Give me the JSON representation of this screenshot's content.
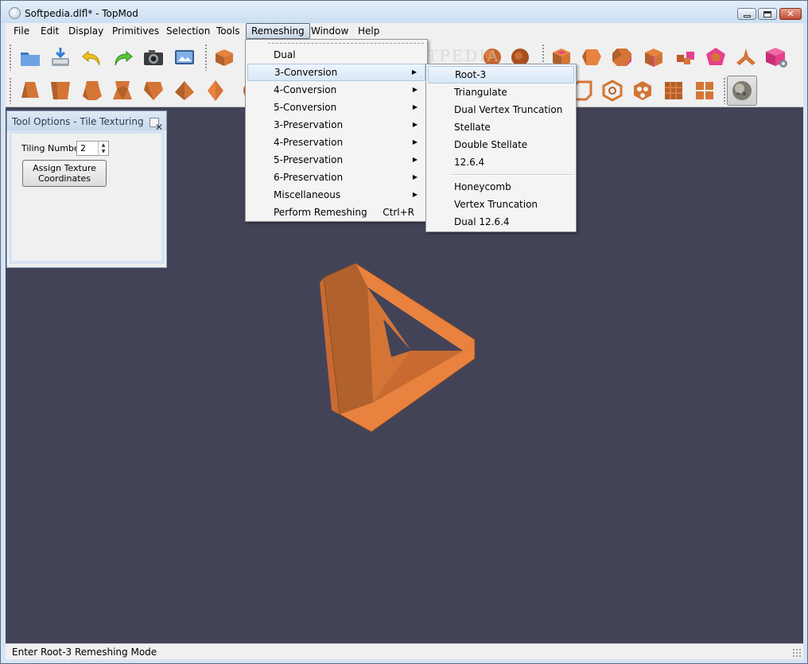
{
  "window": {
    "title": "Softpedia.dlfl* - TopMod",
    "app_icon": "topmod-icon",
    "controls": [
      "minimize-icon",
      "maximize-icon",
      "close-icon"
    ]
  },
  "menubar": {
    "items": [
      "File",
      "Edit",
      "Display",
      "Primitives",
      "Selection",
      "Tools",
      "Remeshing",
      "Window",
      "Help"
    ],
    "active": "Remeshing"
  },
  "toolbar": {
    "row1_left": [
      "open-icon",
      "save-icon",
      "undo-icon",
      "redo-icon",
      "camera-icon",
      "screenshot-icon"
    ],
    "row1_primitives": [
      "cube-icon",
      "cube-pink-icon",
      "sphere-icon"
    ],
    "row1_right": [
      "hole-cube-icon",
      "hex-prism-icon",
      "chamfer-cube-icon",
      "beveled-cube-icon",
      "split-cube-icon",
      "dodecahedron-icon",
      "tripod-icon",
      "cube-gear-icon"
    ],
    "row2_left": [
      "truncated-pyramid-icon",
      "extruded-cube-icon",
      "tapered-cube-icon",
      "star-cube-icon",
      "wedge-icon",
      "pyramid-icon",
      "double-pyramid-icon",
      "sphere-partial-icon"
    ],
    "row2_right": [
      "frame-cube-icon",
      "lattice-cube-icon",
      "cage-cube-icon",
      "grid-cube-icon",
      "tiled-cube-icon",
      "texture-sphere-icon"
    ],
    "pressed": "texture-sphere-icon"
  },
  "tool_panel": {
    "title": "Tool Options - Tile Texturing",
    "tiling_label": "Tiling Number",
    "tiling_value": "2",
    "assign_button": "Assign Texture\nCoordinates"
  },
  "remeshing_menu": {
    "items": [
      {
        "label": "Dual",
        "submenu": false
      },
      {
        "label": "3-Conversion",
        "submenu": true,
        "highlight": true
      },
      {
        "label": "4-Conversion",
        "submenu": true
      },
      {
        "label": "5-Conversion",
        "submenu": true
      },
      {
        "label": "3-Preservation",
        "submenu": true
      },
      {
        "label": "4-Preservation",
        "submenu": true
      },
      {
        "label": "5-Preservation",
        "submenu": true
      },
      {
        "label": "6-Preservation",
        "submenu": true
      },
      {
        "label": "Miscellaneous",
        "submenu": true
      },
      {
        "label": "Perform Remeshing",
        "shortcut": "Ctrl+R"
      }
    ]
  },
  "conversion_submenu": {
    "group1": [
      "Root-3",
      "Triangulate",
      "Dual Vertex Truncation",
      "Stellate",
      "Double Stellate",
      "12.6.4"
    ],
    "group2": [
      "Honeycomb",
      "Vertex Truncation",
      "Dual 12.6.4"
    ],
    "highlight": "Root-3"
  },
  "watermark": "SOFTPEDIA",
  "status": {
    "text": "Enter Root-3 Remeshing Mode"
  },
  "colors": {
    "viewport_bg": "#434358",
    "model_light": "#e8823e",
    "model_mid": "#d47536",
    "model_dark": "#b0612c",
    "pink": "#e8408a"
  }
}
